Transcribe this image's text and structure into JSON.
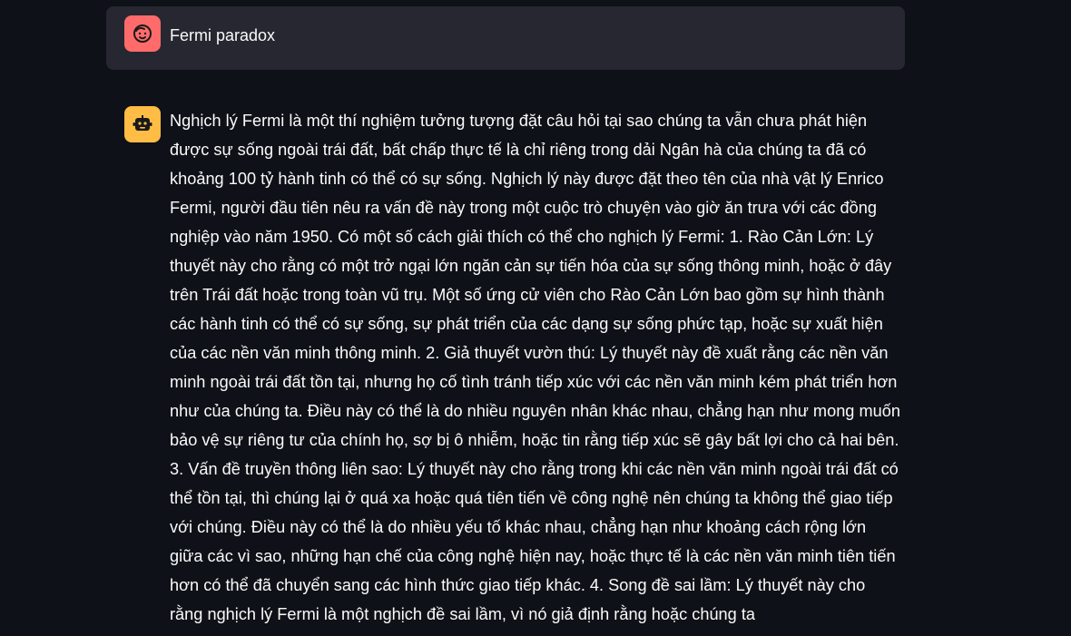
{
  "messages": [
    {
      "role": "user",
      "avatar_icon": "smiley-face-icon",
      "avatar_color": "#ff6b6b",
      "text": "Fermi paradox"
    },
    {
      "role": "assistant",
      "avatar_icon": "robot-face-icon",
      "avatar_color": "#ffbd45",
      "text": "Nghịch lý Fermi là một thí nghiệm tưởng tượng đặt câu hỏi tại sao chúng ta vẫn chưa phát hiện được sự sống ngoài trái đất, bất chấp thực tế là chỉ riêng trong dải Ngân hà của chúng ta đã có khoảng 100 tỷ hành tinh có thể có sự sống. Nghịch lý này được đặt theo tên của nhà vật lý Enrico Fermi, người đầu tiên nêu ra vấn đề này trong một cuộc trò chuyện vào giờ ăn trưa với các đồng nghiệp vào năm 1950. Có một số cách giải thích có thể cho nghịch lý Fermi: 1. Rào Cản Lớn: Lý thuyết này cho rằng có một trở ngại lớn ngăn cản sự tiến hóa của sự sống thông minh, hoặc ở đây trên Trái đất hoặc trong toàn vũ trụ. Một số ứng cử viên cho Rào Cản Lớn bao gồm sự hình thành các hành tinh có thể có sự sống, sự phát triển của các dạng sự sống phức tạp, hoặc sự xuất hiện của các nền văn minh thông minh. 2. Giả thuyết vườn thú: Lý thuyết này đề xuất rằng các nền văn minh ngoài trái đất tồn tại, nhưng họ cố tình tránh tiếp xúc với các nền văn minh kém phát triển hơn như của chúng ta. Điều này có thể là do nhiều nguyên nhân khác nhau, chẳng hạn như mong muốn bảo vệ sự riêng tư của chính họ, sợ bị ô nhiễm, hoặc tin rằng tiếp xúc sẽ gây bất lợi cho cả hai bên. 3. Vấn đề truyền thông liên sao: Lý thuyết này cho rằng trong khi các nền văn minh ngoài trái đất có thể tồn tại, thì chúng lại ở quá xa hoặc quá tiên tiến về công nghệ nên chúng ta không thể giao tiếp với chúng. Điều này có thể là do nhiều yếu tố khác nhau, chẳng hạn như khoảng cách rộng lớn giữa các vì sao, những hạn chế của công nghệ hiện nay, hoặc thực tế là các nền văn minh tiên tiến hơn có thể đã chuyển sang các hình thức giao tiếp khác. 4. Song đề sai lầm: Lý thuyết này cho rằng nghịch lý Fermi là một nghịch đề sai lầm, vì nó giả định rằng hoặc chúng ta"
    }
  ]
}
